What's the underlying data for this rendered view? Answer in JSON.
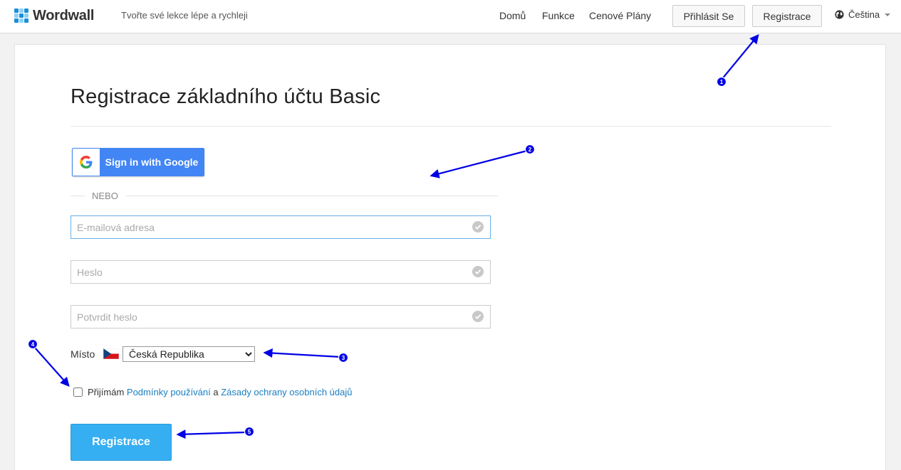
{
  "header": {
    "logo_text": "Wordwall",
    "tagline": "Tvořte své lekce lépe a rychleji",
    "nav": [
      {
        "label": "Domů"
      },
      {
        "label": "Funkce"
      },
      {
        "label": "Cenové Plány"
      }
    ],
    "login_label": "Přihlásit Se",
    "register_label": "Registrace",
    "language": "Čeština"
  },
  "form": {
    "title": "Registrace základního účtu Basic",
    "google_label": "Sign in with Google",
    "or_label": "NEBO",
    "email_placeholder": "E-mailová adresa",
    "password_placeholder": "Heslo",
    "confirm_placeholder": "Potvrdit heslo",
    "place_label": "Místo",
    "country_selected": "Česká Republika",
    "terms_prefix": "Přijímám",
    "terms_link": "Podmínky používání",
    "terms_and": "a",
    "privacy_link": "Zásady ochrany osobních údajů",
    "submit_label": "Registrace"
  },
  "annotations": {
    "color": "#0000e6",
    "markers": [
      "1",
      "2",
      "3",
      "4",
      "5"
    ]
  },
  "colors": {
    "accent": "#36aff2",
    "link": "#1a7fc1",
    "google_blue": "#4285f4"
  }
}
